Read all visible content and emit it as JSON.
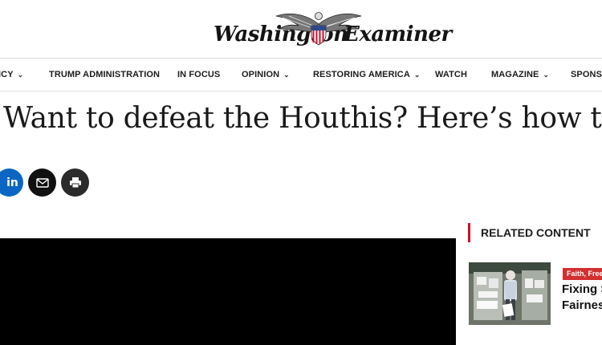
{
  "masthead": {
    "logo_word_left": "Washington",
    "logo_word_right": "Examiner",
    "emblem_icon": "eagle-shield-icon"
  },
  "nav": {
    "items": [
      {
        "label": "ICY",
        "dropdown": true
      },
      {
        "label": "TRUMP ADMINISTRATION",
        "dropdown": false
      },
      {
        "label": "IN FOCUS",
        "dropdown": false
      },
      {
        "label": "OPINION",
        "dropdown": true
      },
      {
        "label": "RESTORING AMERICA",
        "dropdown": true
      },
      {
        "label": "WATCH",
        "dropdown": false
      },
      {
        "label": "MAGAZINE",
        "dropdown": true
      },
      {
        "label": "SPONSO",
        "dropdown": false
      }
    ],
    "chevron_glyph": "⌄"
  },
  "article": {
    "headline": "Want to defeat the Houthis? Here’s how to do"
  },
  "share": {
    "buttons": [
      {
        "icon": "linkedin-icon",
        "text": "in",
        "color": "#0a66c2"
      },
      {
        "icon": "email-icon",
        "color": "#111111"
      },
      {
        "icon": "print-icon",
        "color": "#2b2b2b"
      }
    ]
  },
  "related": {
    "heading": "RELATED CONTENT",
    "accent_color": "#c8102e",
    "item": {
      "tag": "Faith, Free",
      "title_line1": "Fixing S",
      "title_line2": "Fairness"
    }
  }
}
